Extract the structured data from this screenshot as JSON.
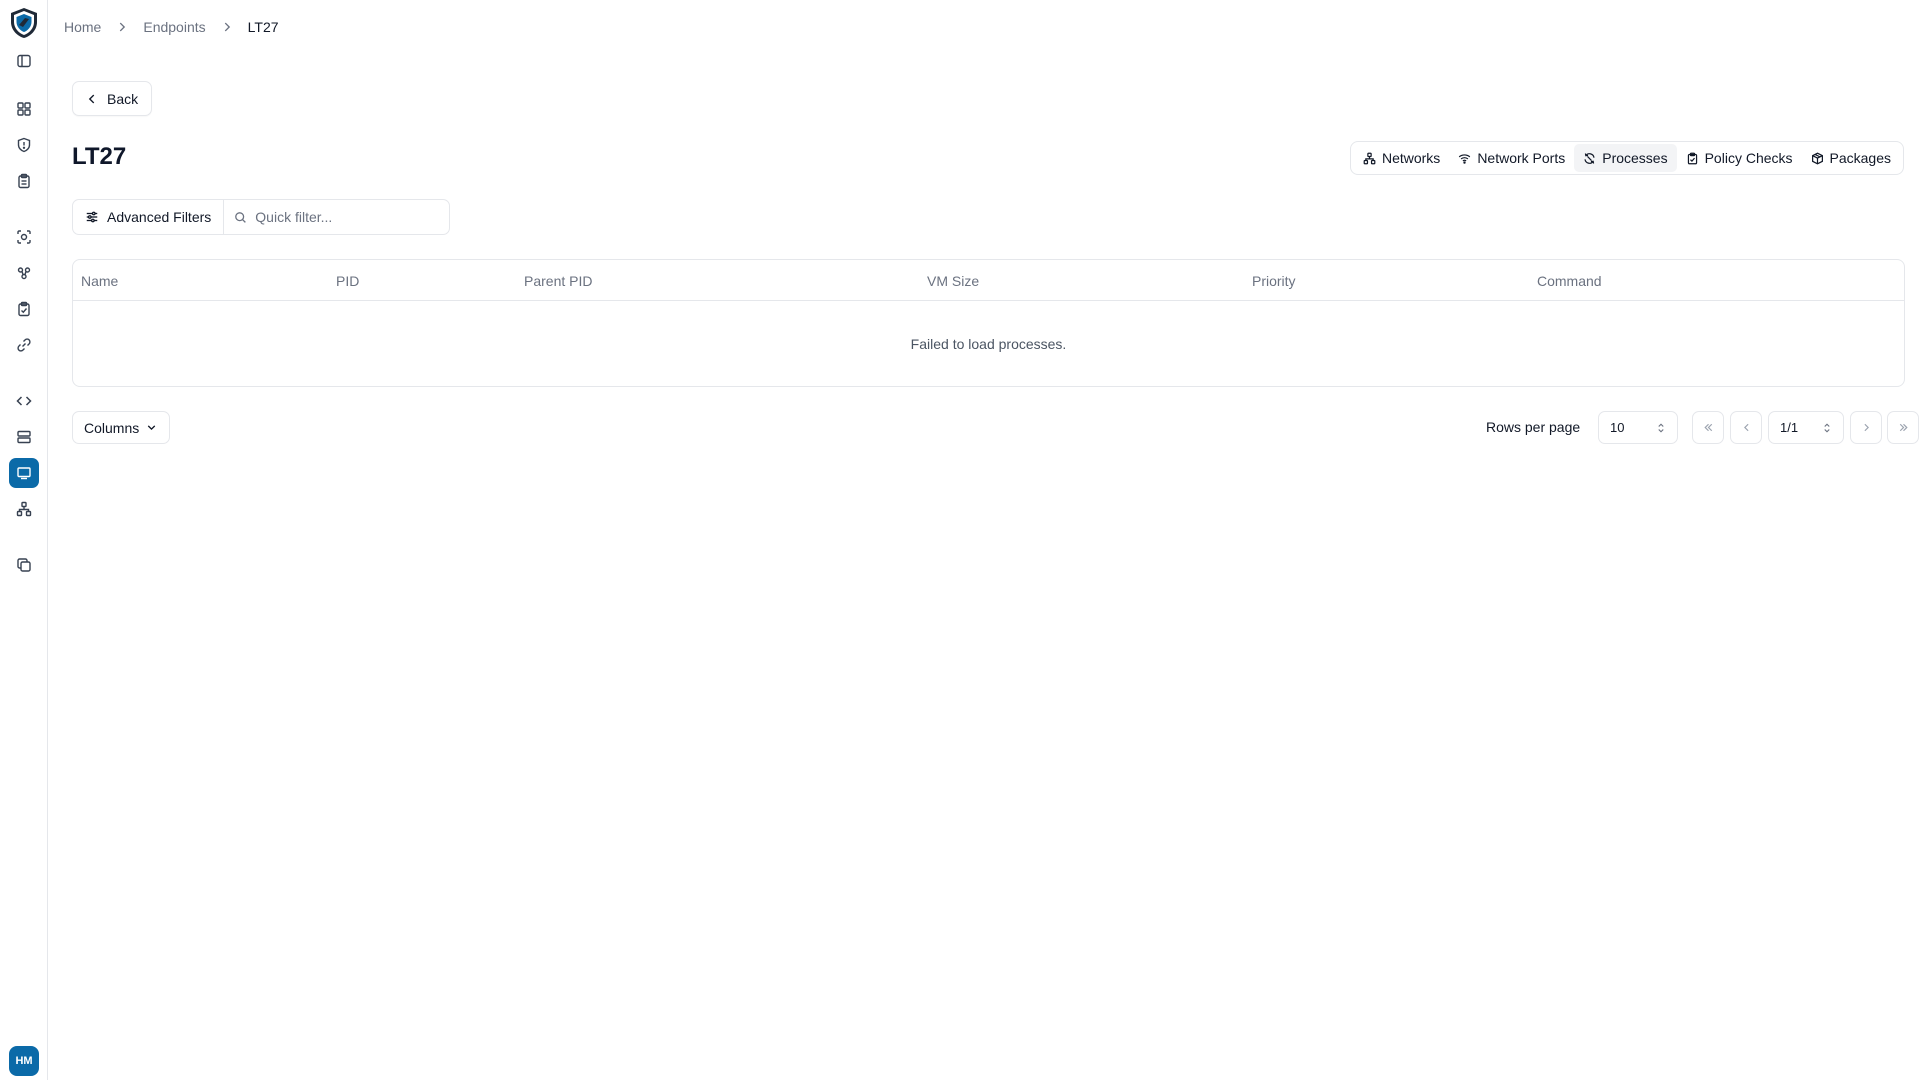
{
  "breadcrumb": {
    "home": "Home",
    "endpoints": "Endpoints",
    "current": "LT27"
  },
  "back_label": "Back",
  "page_title": "LT27",
  "tabs": [
    {
      "label": "Networks",
      "icon": "network-icon"
    },
    {
      "label": "Network Ports",
      "icon": "wifi-icon"
    },
    {
      "label": "Processes",
      "icon": "processes-icon",
      "active": true
    },
    {
      "label": "Policy Checks",
      "icon": "clipboard-check-icon"
    },
    {
      "label": "Packages",
      "icon": "package-icon"
    }
  ],
  "filters": {
    "advanced_label": "Advanced Filters",
    "quick_placeholder": "Quick filter..."
  },
  "table": {
    "columns": [
      "Name",
      "PID",
      "Parent PID",
      "VM Size",
      "Priority",
      "Command"
    ],
    "empty_message": "Failed to load processes."
  },
  "footer": {
    "columns_label": "Columns",
    "rows_per_page_label": "Rows per page",
    "rows_per_page_value": "10",
    "page_value": "1/1"
  },
  "user": {
    "initials": "HM"
  },
  "colors": {
    "accent": "#0b6aa8",
    "border": "#e5e7eb",
    "muted_text": "#6b7280"
  }
}
